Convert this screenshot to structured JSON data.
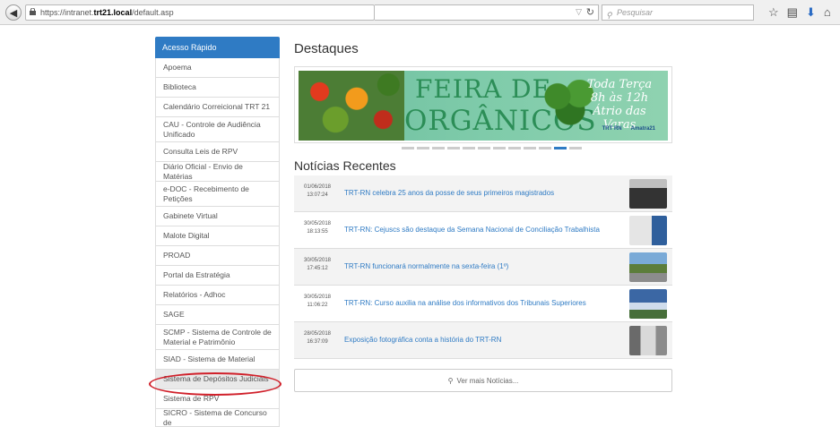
{
  "browser": {
    "url_prefix": "https://intranet.",
    "url_host": "trt21.local",
    "url_path": "/default.asp",
    "search_placeholder": "Pesquisar"
  },
  "sidebar": {
    "header": "Acesso Rápido",
    "items": [
      {
        "label": "Apoema"
      },
      {
        "label": "Biblioteca"
      },
      {
        "label": "Calendário Correicional TRT 21"
      },
      {
        "label": "CAU - Controle de Audiência Unificado"
      },
      {
        "label": "Consulta Leis de RPV"
      },
      {
        "label": "Diário Oficial - Envio de Matérias"
      },
      {
        "label": "e-DOC - Recebimento de Petições"
      },
      {
        "label": "Gabinete Virtual"
      },
      {
        "label": "Malote Digital"
      },
      {
        "label": "PROAD"
      },
      {
        "label": "Portal da Estratégia"
      },
      {
        "label": "Relatórios - Adhoc"
      },
      {
        "label": "SAGE"
      },
      {
        "label": "SCMP - Sistema de Controle de Material e Patrimônio"
      },
      {
        "label": "SIAD - Sistema de Material"
      },
      {
        "label": "Sistema de Depósitos Judiciais"
      },
      {
        "label": "Sistema de RPV"
      },
      {
        "label": "SICRO - Sistema de Concurso de"
      }
    ]
  },
  "main": {
    "destaques_title": "Destaques",
    "banner": {
      "line1": "FEIRA DE",
      "line2": "ORGÂNICOS",
      "side_line1": "Toda Terça",
      "side_line2": "8h às 12h",
      "side_line3": "Átrio das Varas",
      "logo1": "TRT RN",
      "logo2": "Amatra21"
    },
    "news_title": "Notícias Recentes",
    "news": [
      {
        "date": "01/06/2018",
        "time": "13:07:24",
        "title": "TRT-RN celebra 25 anos da posse de seus primeiros magistrados"
      },
      {
        "date": "30/05/2018",
        "time": "18:13:55",
        "title": "TRT-RN: Cejuscs são destaque da Semana Nacional de Conciliação Trabalhista"
      },
      {
        "date": "30/05/2018",
        "time": "17:45:12",
        "title": "TRT-RN funcionará normalmente na sexta-feira (1º)"
      },
      {
        "date": "30/05/2018",
        "time": "11:06:22",
        "title": "TRT-RN: Curso auxilia na análise dos informativos dos Tribunais Superiores"
      },
      {
        "date": "28/05/2018",
        "time": "16:37:09",
        "title": "Exposição fotográfica conta a história do TRT-RN"
      }
    ],
    "more_label": "Ver mais Notícias..."
  }
}
